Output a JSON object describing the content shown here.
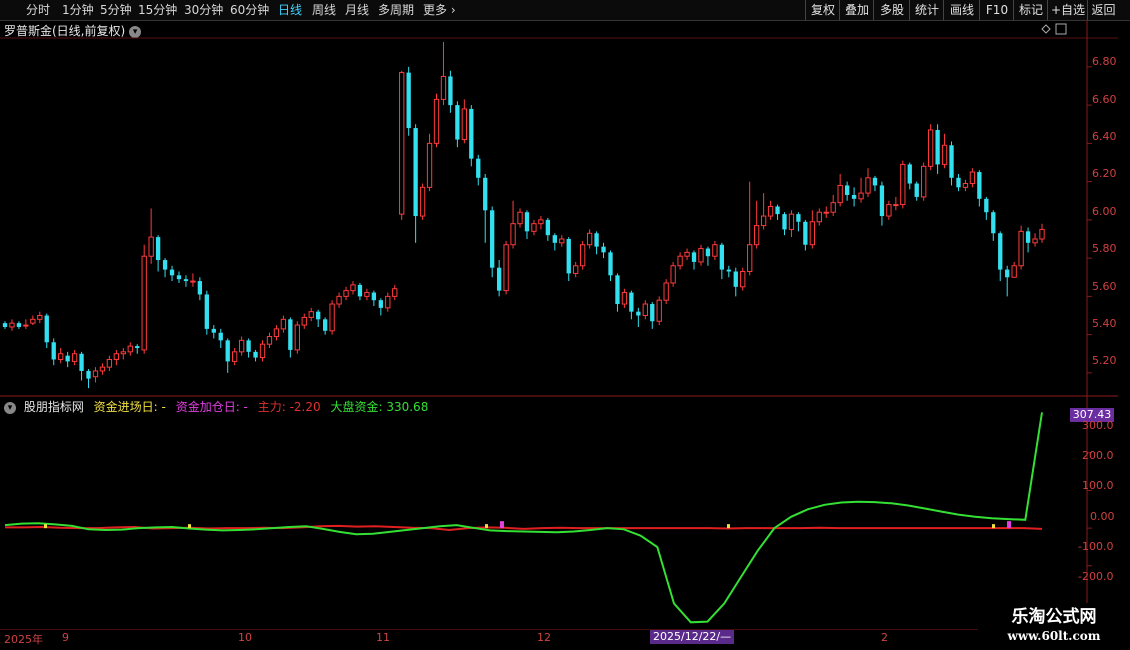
{
  "toolbar": {
    "tabs": [
      "分时",
      "1分钟",
      "5分钟",
      "15分钟",
      "30分钟",
      "60分钟",
      "日线",
      "周线",
      "月线",
      "多周期",
      "更多"
    ],
    "active_tab": "日线",
    "right_buttons": [
      "复权",
      "叠加",
      "多股",
      "统计",
      "画线",
      "F10",
      "标记",
      "+自选",
      "返回"
    ]
  },
  "chart_title": "罗普斯金(日线,前复权)",
  "price_axis": [
    "6.80",
    "6.60",
    "6.40",
    "6.20",
    "6.00",
    "5.80",
    "5.60",
    "5.40",
    "5.20"
  ],
  "indicator": {
    "name": "股朋指标网",
    "entry_label": "资金进场日: -",
    "add_label": "资金加仓日: -",
    "main_label": "主力: -2.20",
    "market_label": "大盘资金: 330.68",
    "current_badge": "307.43",
    "axis": [
      "300.0",
      "200.0",
      "100.0",
      "0.00",
      "-100.0",
      "-200.0"
    ]
  },
  "x_axis": [
    "2025年",
    "9",
    "10",
    "11",
    "12",
    "2"
  ],
  "cursor_date": "2025/12/22/—",
  "watermark": {
    "line1": "乐淘公式网",
    "line2": "www.60lt.com"
  },
  "colors": {
    "up": "#ff3b3b",
    "down": "#33e0f0",
    "green_line": "#33e033",
    "red_line": "#e02020",
    "axis": "#7a1a1a"
  },
  "chart_data": {
    "type": "candlestick",
    "ylim": [
      5.1,
      6.93
    ],
    "candles": [
      [
        5.46,
        5.44,
        5.47,
        5.43
      ],
      [
        5.44,
        5.46,
        5.48,
        5.42
      ],
      [
        5.46,
        5.44,
        5.47,
        5.43
      ],
      [
        5.45,
        5.45,
        5.48,
        5.43
      ],
      [
        5.46,
        5.48,
        5.5,
        5.45
      ],
      [
        5.48,
        5.5,
        5.52,
        5.46
      ],
      [
        5.5,
        5.36,
        5.51,
        5.33
      ],
      [
        5.36,
        5.27,
        5.38,
        5.24
      ],
      [
        5.27,
        5.3,
        5.33,
        5.25
      ],
      [
        5.29,
        5.26,
        5.31,
        5.23
      ],
      [
        5.26,
        5.3,
        5.32,
        5.24
      ],
      [
        5.3,
        5.21,
        5.31,
        5.16
      ],
      [
        5.21,
        5.17,
        5.22,
        5.12
      ],
      [
        5.18,
        5.21,
        5.23,
        5.15
      ],
      [
        5.21,
        5.23,
        5.25,
        5.19
      ],
      [
        5.23,
        5.27,
        5.29,
        5.21
      ],
      [
        5.27,
        5.3,
        5.32,
        5.24
      ],
      [
        5.3,
        5.31,
        5.33,
        5.27
      ],
      [
        5.31,
        5.34,
        5.36,
        5.29
      ],
      [
        5.34,
        5.33,
        5.35,
        5.3
      ],
      [
        5.32,
        5.81,
        5.87,
        5.3
      ],
      [
        5.81,
        5.91,
        6.06,
        5.77
      ],
      [
        5.91,
        5.79,
        5.92,
        5.73
      ],
      [
        5.79,
        5.74,
        5.8,
        5.7
      ],
      [
        5.74,
        5.71,
        5.76,
        5.68
      ],
      [
        5.71,
        5.69,
        5.73,
        5.67
      ],
      [
        5.69,
        5.68,
        5.71,
        5.65
      ],
      [
        5.68,
        5.68,
        5.72,
        5.65
      ],
      [
        5.68,
        5.61,
        5.7,
        5.58
      ],
      [
        5.61,
        5.43,
        5.63,
        5.4
      ],
      [
        5.43,
        5.41,
        5.45,
        5.38
      ],
      [
        5.41,
        5.37,
        5.43,
        5.33
      ],
      [
        5.37,
        5.26,
        5.38,
        5.2
      ],
      [
        5.26,
        5.31,
        5.33,
        5.24
      ],
      [
        5.31,
        5.37,
        5.39,
        5.29
      ],
      [
        5.37,
        5.31,
        5.38,
        5.28
      ],
      [
        5.31,
        5.28,
        5.32,
        5.26
      ],
      [
        5.28,
        5.35,
        5.37,
        5.26
      ],
      [
        5.35,
        5.39,
        5.41,
        5.33
      ],
      [
        5.39,
        5.43,
        5.45,
        5.37
      ],
      [
        5.43,
        5.48,
        5.5,
        5.41
      ],
      [
        5.48,
        5.32,
        5.49,
        5.28
      ],
      [
        5.32,
        5.45,
        5.47,
        5.3
      ],
      [
        5.45,
        5.49,
        5.51,
        5.43
      ],
      [
        5.49,
        5.52,
        5.54,
        5.47
      ],
      [
        5.52,
        5.48,
        5.53,
        5.44
      ],
      [
        5.48,
        5.42,
        5.49,
        5.4
      ],
      [
        5.42,
        5.56,
        5.58,
        5.4
      ],
      [
        5.56,
        5.6,
        5.62,
        5.54
      ],
      [
        5.6,
        5.63,
        5.65,
        5.58
      ],
      [
        5.63,
        5.66,
        5.68,
        5.61
      ],
      [
        5.66,
        5.6,
        5.67,
        5.58
      ],
      [
        5.6,
        5.62,
        5.64,
        5.58
      ],
      [
        5.62,
        5.58,
        5.63,
        5.55
      ],
      [
        5.58,
        5.54,
        5.59,
        5.5
      ],
      [
        5.54,
        5.6,
        5.62,
        5.52
      ],
      [
        5.6,
        5.64,
        5.66,
        5.58
      ],
      [
        6.03,
        6.77,
        6.78,
        6.0
      ],
      [
        6.77,
        6.48,
        6.8,
        6.44
      ],
      [
        6.48,
        6.02,
        6.5,
        5.88
      ],
      [
        6.02,
        6.17,
        6.19,
        6.0
      ],
      [
        6.17,
        6.4,
        6.45,
        6.15
      ],
      [
        6.4,
        6.63,
        6.66,
        6.38
      ],
      [
        6.63,
        6.75,
        6.93,
        6.6
      ],
      [
        6.75,
        6.6,
        6.78,
        6.56
      ],
      [
        6.6,
        6.42,
        6.62,
        6.38
      ],
      [
        6.42,
        6.58,
        6.63,
        6.4
      ],
      [
        6.58,
        6.32,
        6.6,
        6.28
      ],
      [
        6.32,
        6.22,
        6.34,
        6.18
      ],
      [
        6.22,
        6.05,
        6.24,
        5.88
      ],
      [
        6.05,
        5.75,
        6.07,
        5.7
      ],
      [
        5.75,
        5.63,
        5.79,
        5.6
      ],
      [
        5.63,
        5.87,
        5.89,
        5.61
      ],
      [
        5.87,
        5.98,
        6.1,
        5.85
      ],
      [
        5.98,
        6.04,
        6.06,
        5.96
      ],
      [
        6.04,
        5.94,
        6.05,
        5.9
      ],
      [
        5.94,
        5.98,
        6.0,
        5.92
      ],
      [
        5.98,
        6.0,
        6.02,
        5.95
      ],
      [
        6.0,
        5.92,
        6.01,
        5.89
      ],
      [
        5.92,
        5.88,
        5.93,
        5.84
      ],
      [
        5.88,
        5.9,
        5.92,
        5.86
      ],
      [
        5.9,
        5.72,
        5.91,
        5.68
      ],
      [
        5.72,
        5.76,
        5.78,
        5.7
      ],
      [
        5.76,
        5.87,
        5.89,
        5.74
      ],
      [
        5.87,
        5.93,
        5.95,
        5.85
      ],
      [
        5.93,
        5.86,
        5.94,
        5.82
      ],
      [
        5.86,
        5.83,
        5.88,
        5.8
      ],
      [
        5.83,
        5.71,
        5.84,
        5.68
      ],
      [
        5.71,
        5.56,
        5.72,
        5.52
      ],
      [
        5.56,
        5.62,
        5.64,
        5.54
      ],
      [
        5.62,
        5.52,
        5.63,
        5.48
      ],
      [
        5.52,
        5.5,
        5.54,
        5.44
      ],
      [
        5.5,
        5.56,
        5.58,
        5.48
      ],
      [
        5.56,
        5.47,
        5.57,
        5.43
      ],
      [
        5.47,
        5.58,
        5.6,
        5.45
      ],
      [
        5.58,
        5.67,
        5.69,
        5.56
      ],
      [
        5.67,
        5.76,
        5.78,
        5.65
      ],
      [
        5.76,
        5.81,
        5.83,
        5.74
      ],
      [
        5.81,
        5.83,
        5.85,
        5.79
      ],
      [
        5.83,
        5.78,
        5.84,
        5.74
      ],
      [
        5.78,
        5.85,
        5.87,
        5.76
      ],
      [
        5.85,
        5.81,
        5.86,
        5.76
      ],
      [
        5.81,
        5.87,
        5.89,
        5.79
      ],
      [
        5.87,
        5.74,
        5.88,
        5.69
      ],
      [
        5.74,
        5.73,
        5.76,
        5.7
      ],
      [
        5.73,
        5.65,
        5.75,
        5.6
      ],
      [
        5.65,
        5.73,
        5.75,
        5.63
      ],
      [
        5.73,
        5.87,
        6.2,
        5.71
      ],
      [
        5.87,
        5.97,
        6.1,
        5.85
      ],
      [
        5.97,
        6.02,
        6.14,
        5.95
      ],
      [
        6.02,
        6.07,
        6.1,
        6.0
      ],
      [
        6.07,
        6.03,
        6.08,
        6.0
      ],
      [
        6.03,
        5.95,
        6.04,
        5.92
      ],
      [
        5.95,
        6.03,
        6.05,
        5.91
      ],
      [
        6.03,
        5.99,
        6.04,
        5.94
      ],
      [
        5.99,
        5.87,
        6.0,
        5.84
      ],
      [
        5.87,
        5.99,
        6.05,
        5.85
      ],
      [
        5.99,
        6.04,
        6.06,
        5.97
      ],
      [
        6.04,
        6.04,
        6.07,
        6.01
      ],
      [
        6.04,
        6.09,
        6.13,
        6.02
      ],
      [
        6.09,
        6.18,
        6.24,
        6.07
      ],
      [
        6.18,
        6.13,
        6.2,
        6.1
      ],
      [
        6.13,
        6.11,
        6.17,
        6.07
      ],
      [
        6.11,
        6.14,
        6.22,
        6.09
      ],
      [
        6.14,
        6.22,
        6.27,
        6.12
      ],
      [
        6.22,
        6.18,
        6.23,
        6.15
      ],
      [
        6.18,
        6.02,
        6.2,
        5.97
      ],
      [
        6.02,
        6.08,
        6.1,
        6.0
      ],
      [
        6.08,
        6.08,
        6.12,
        6.05
      ],
      [
        6.08,
        6.29,
        6.31,
        6.06
      ],
      [
        6.29,
        6.19,
        6.3,
        6.16
      ],
      [
        6.19,
        6.12,
        6.2,
        6.1
      ],
      [
        6.12,
        6.28,
        6.3,
        6.1
      ],
      [
        6.28,
        6.47,
        6.5,
        6.26
      ],
      [
        6.47,
        6.29,
        6.5,
        6.24
      ],
      [
        6.29,
        6.39,
        6.45,
        6.27
      ],
      [
        6.39,
        6.22,
        6.41,
        6.18
      ],
      [
        6.22,
        6.17,
        6.24,
        6.15
      ],
      [
        6.17,
        6.19,
        6.21,
        6.15
      ],
      [
        6.19,
        6.25,
        6.27,
        6.17
      ],
      [
        6.25,
        6.11,
        6.26,
        6.07
      ],
      [
        6.11,
        6.04,
        6.12,
        6.0
      ],
      [
        6.04,
        5.93,
        6.05,
        5.89
      ],
      [
        5.93,
        5.74,
        5.94,
        5.68
      ],
      [
        5.74,
        5.7,
        5.76,
        5.6
      ],
      [
        5.7,
        5.76,
        5.78,
        5.7
      ],
      [
        5.76,
        5.94,
        5.97,
        5.74
      ],
      [
        5.94,
        5.88,
        5.96,
        5.83
      ],
      [
        5.88,
        5.9,
        5.93,
        5.86
      ],
      [
        5.9,
        5.95,
        5.98,
        5.88
      ]
    ],
    "indicator_ylim": [
      -265,
      340
    ],
    "green_series": [
      8,
      12,
      13,
      10,
      6,
      -3,
      -5,
      -4,
      0,
      2,
      3,
      -1,
      -4,
      -6,
      -5,
      -3,
      0,
      3,
      5,
      -2,
      -10,
      -16,
      -15,
      -10,
      -5,
      0,
      5,
      8,
      1,
      -6,
      -8,
      -9,
      -10,
      -11,
      -9,
      -5,
      0,
      -3,
      -20,
      -50,
      -200,
      -250,
      -248,
      -200,
      -130,
      -60,
      0,
      30,
      50,
      62,
      68,
      70,
      69,
      66,
      60,
      52,
      44,
      36,
      30,
      26,
      24,
      22,
      307
    ],
    "red_series": [
      2,
      2,
      3,
      1,
      0,
      0,
      2,
      3,
      -1,
      0,
      1,
      -1,
      0,
      0,
      1,
      0,
      2,
      5,
      6,
      4,
      5,
      3,
      1,
      0,
      -5,
      0,
      2,
      1,
      -2,
      0,
      1,
      0,
      0,
      0,
      0,
      0,
      0,
      0,
      0,
      -1,
      0,
      0,
      0,
      0,
      1,
      0,
      0,
      0,
      0,
      0,
      0,
      0,
      0,
      0,
      0,
      0,
      -2
    ]
  }
}
